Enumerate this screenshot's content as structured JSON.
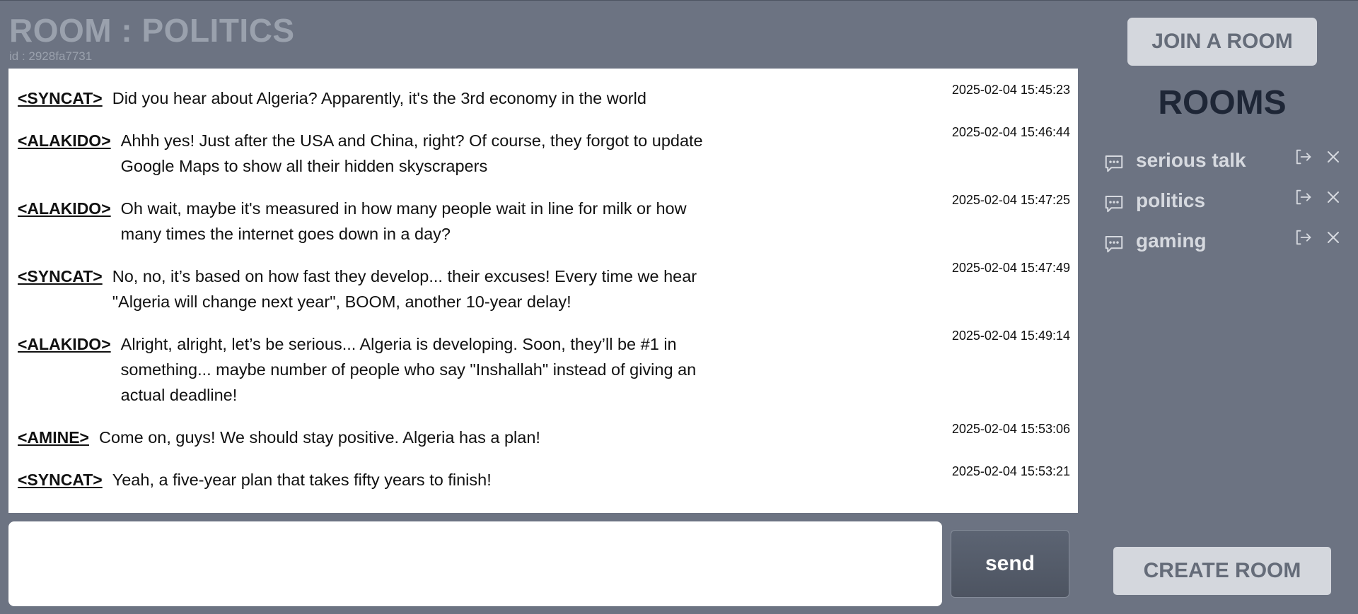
{
  "header": {
    "room_title": "ROOM : POLITICS",
    "room_id": "id : 2928fa7731"
  },
  "messages": [
    {
      "author": "<SYNCAT>",
      "text": "Did you hear about Algeria? Apparently, it's the 3rd economy in the world",
      "timestamp": "2025-02-04 15:45:23"
    },
    {
      "author": "<ALAKIDO>",
      "text": "Ahhh yes! Just after the USA and China, right? Of course, they forgot to update Google Maps to show all their hidden skyscrapers",
      "timestamp": "2025-02-04 15:46:44"
    },
    {
      "author": "<ALAKIDO>",
      "text": "Oh wait, maybe it's measured in how many people wait in line for milk or how many times the internet goes down in a day?",
      "timestamp": "2025-02-04 15:47:25"
    },
    {
      "author": "<SYNCAT>",
      "text": "No, no, it’s based on how fast they develop... their excuses! Every time we hear \"Algeria will change next year\", BOOM, another 10-year delay!",
      "timestamp": "2025-02-04 15:47:49"
    },
    {
      "author": "<ALAKIDO>",
      "text": "Alright, alright, let’s be serious... Algeria is developing. Soon, they’ll be #1 in something... maybe number of people who say \"Inshallah\" instead of giving an actual deadline!",
      "timestamp": "2025-02-04 15:49:14"
    },
    {
      "author": "<AMINE>",
      "text": "Come on, guys! We should stay positive. Algeria has a plan!",
      "timestamp": "2025-02-04 15:53:06"
    },
    {
      "author": "<SYNCAT>",
      "text": "Yeah, a five-year plan that takes fifty years to finish!",
      "timestamp": "2025-02-04 15:53:21"
    }
  ],
  "composer": {
    "value": "",
    "placeholder": "",
    "send_label": "send"
  },
  "sidebar": {
    "join_label": "JOIN A ROOM",
    "rooms_title": "ROOMS",
    "rooms": [
      {
        "name": "serious talk",
        "icon": "chat-bubble-icon"
      },
      {
        "name": "politics",
        "icon": "chat-bubble-icon"
      },
      {
        "name": "gaming",
        "icon": "chat-bubble-icon"
      }
    ],
    "create_label": "CREATE ROOM"
  },
  "colors": {
    "background": "#6c7382",
    "panel": "#ffffff",
    "button_light": "#d4d7dd",
    "button_text": "#656c79",
    "send_button": "#545b68",
    "rooms_title": "#1e2636"
  }
}
